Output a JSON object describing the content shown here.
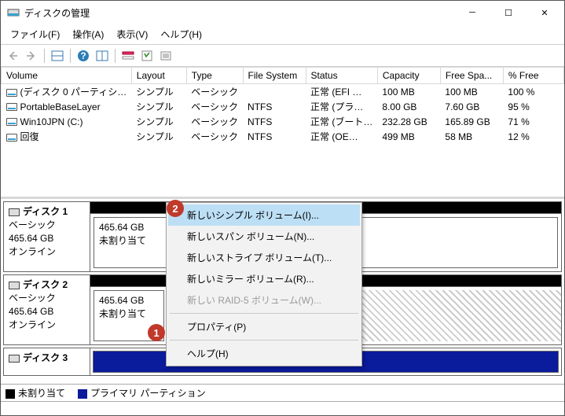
{
  "window": {
    "title": "ディスクの管理"
  },
  "menu": {
    "file": "ファイル(F)",
    "action": "操作(A)",
    "view": "表示(V)",
    "help": "ヘルプ(H)"
  },
  "columns": {
    "volume": "Volume",
    "layout": "Layout",
    "type": "Type",
    "fs": "File System",
    "status": "Status",
    "capacity": "Capacity",
    "free": "Free Spa...",
    "pct": "% Free"
  },
  "volumes": [
    {
      "name": "(ディスク 0 パーティシ…",
      "layout": "シンプル",
      "type": "ベーシック",
      "fs": "",
      "status": "正常 (EFI …",
      "capacity": "100 MB",
      "free": "100 MB",
      "pct": "100 %"
    },
    {
      "name": "PortableBaseLayer",
      "layout": "シンプル",
      "type": "ベーシック",
      "fs": "NTFS",
      "status": "正常 (プラ…",
      "capacity": "8.00 GB",
      "free": "7.60 GB",
      "pct": "95 %"
    },
    {
      "name": "Win10JPN (C:)",
      "layout": "シンプル",
      "type": "ベーシック",
      "fs": "NTFS",
      "status": "正常 (ブート…",
      "capacity": "232.28 GB",
      "free": "165.89 GB",
      "pct": "71 %"
    },
    {
      "name": "回復",
      "layout": "シンプル",
      "type": "ベーシック",
      "fs": "NTFS",
      "status": "正常 (OE…",
      "capacity": "499 MB",
      "free": "58 MB",
      "pct": "12 %"
    }
  ],
  "disks": [
    {
      "name": "ディスク 1",
      "type": "ベーシック",
      "size": "465.64 GB",
      "status": "オンライン",
      "alloc_size": "465.64 GB",
      "alloc_state": "未割り当て"
    },
    {
      "name": "ディスク 2",
      "type": "ベーシック",
      "size": "465.64 GB",
      "status": "オンライン",
      "alloc_size": "465.64 GB",
      "alloc_state": "未割り当て"
    },
    {
      "name": "ディスク 3"
    }
  ],
  "legend": {
    "unallocated": "未割り当て",
    "primary": "プライマリ パーティション"
  },
  "context_menu": {
    "simple": "新しいシンプル ボリューム(I)...",
    "spanned": "新しいスパン ボリューム(N)...",
    "striped": "新しいストライプ ボリューム(T)...",
    "mirror": "新しいミラー ボリューム(R)...",
    "raid5": "新しい RAID-5 ボリューム(W)...",
    "properties": "プロパティ(P)",
    "help": "ヘルプ(H)"
  },
  "annotations": {
    "b1": "1",
    "b2": "2"
  }
}
